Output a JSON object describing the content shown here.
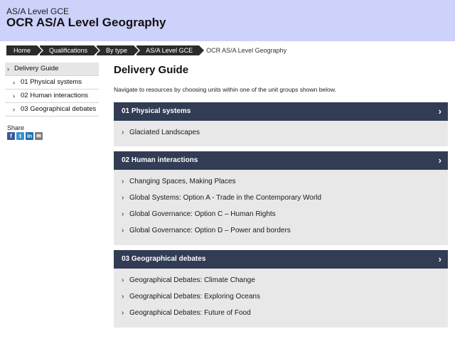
{
  "header": {
    "subtitle": "AS/A Level GCE",
    "title": "OCR AS/A Level Geography"
  },
  "breadcrumb": {
    "items": [
      "Home",
      "Qualifications",
      "By type",
      "AS/A Level GCE"
    ],
    "current": "OCR AS/A Level Geography"
  },
  "sidebar": {
    "items": [
      {
        "label": "Delivery Guide"
      },
      {
        "label": "01 Physical systems"
      },
      {
        "label": "02 Human interactions"
      },
      {
        "label": "03 Geographical debates"
      }
    ],
    "chevron": "›"
  },
  "share": {
    "label": "Share",
    "icons": [
      {
        "name": "facebook-icon",
        "glyph": "f",
        "color": "#3b5998"
      },
      {
        "name": "twitter-icon",
        "glyph": "t",
        "color": "#3a92d0"
      },
      {
        "name": "linkedin-icon",
        "glyph": "in",
        "color": "#1f6fa8"
      },
      {
        "name": "email-icon",
        "glyph": "✉",
        "color": "#7a7a7a"
      }
    ]
  },
  "main": {
    "title": "Delivery Guide",
    "intro": "Navigate to resources by choosing units within one of the unit groups shown below.",
    "groups": [
      {
        "title": "01 Physical systems",
        "units": [
          "Glaciated Landscapes"
        ]
      },
      {
        "title": "02 Human interactions",
        "units": [
          "Changing Spaces, Making Places",
          "Global Systems: Option A - Trade in the Contemporary World",
          "Global Governance: Option C – Human Rights",
          "Global Governance: Option D – Power and borders"
        ]
      },
      {
        "title": "03 Geographical debates",
        "units": [
          "Geographical Debates: Climate Change",
          "Geographical Debates: Exploring Oceans",
          "Geographical Debates: Future of Food"
        ]
      }
    ]
  },
  "colors": {
    "header_bg": "#cdd2fb",
    "group_header_bg": "#323c54",
    "group_body_bg": "#e8e8e8",
    "breadcrumb_bg": "#2b2b2b"
  }
}
